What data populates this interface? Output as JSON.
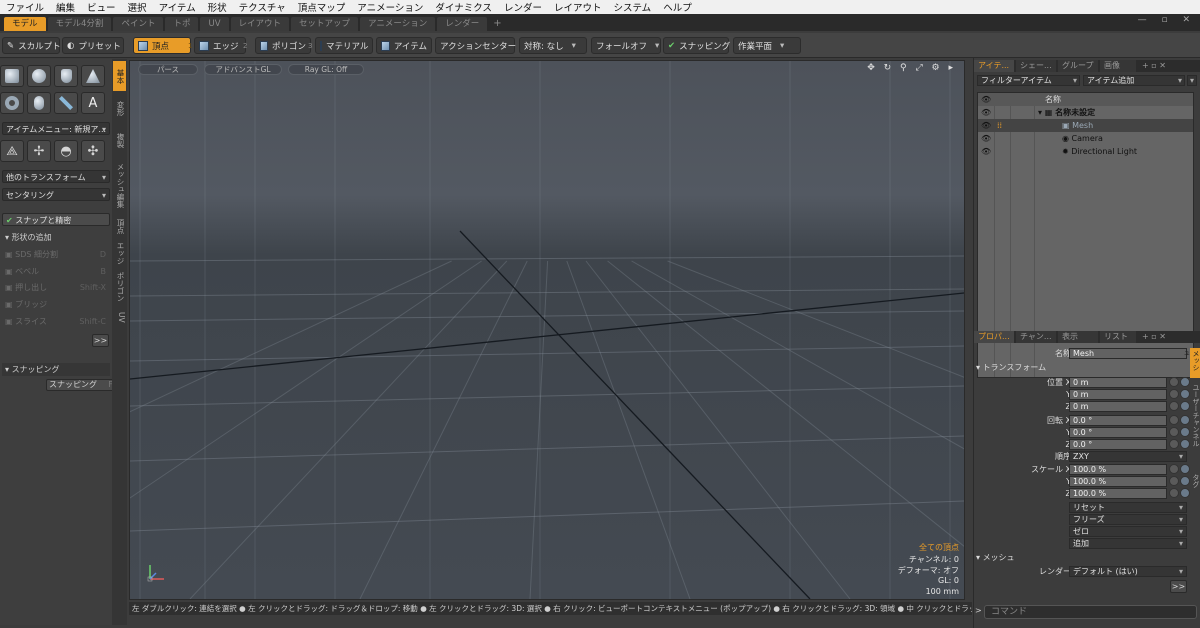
{
  "menubar": [
    "ファイル",
    "編集",
    "ビュー",
    "選択",
    "アイテム",
    "形状",
    "テクスチャ",
    "頂点マップ",
    "アニメーション",
    "ダイナミクス",
    "レンダー",
    "レイアウト",
    "システム",
    "ヘルプ"
  ],
  "layout_tabs": [
    {
      "label": "モデル",
      "active": true
    },
    {
      "label": "モデル4分割",
      "active": false
    },
    {
      "label": "ペイント",
      "active": false
    },
    {
      "label": "トポ",
      "active": false
    },
    {
      "label": "UV",
      "active": false
    },
    {
      "label": "レイアウト",
      "active": false
    },
    {
      "label": "セットアップ",
      "active": false
    },
    {
      "label": "アニメーション",
      "active": false
    },
    {
      "label": "レンダー",
      "active": false
    }
  ],
  "layout_tabs_add": "+",
  "window_controls": "— ▫ ✕",
  "toolbar": {
    "sculpt": "スカルプト",
    "preset": "プリセット",
    "vertex": "頂点",
    "vertex_num": "1",
    "edge": "エッジ",
    "edge_num": "2",
    "polygon": "ポリゴン",
    "polygon_num": "3",
    "material": "マテリアル",
    "item": "アイテム",
    "action_center": "アクションセンター",
    "symmetry": "対称: なし",
    "falloff": "フォールオフ",
    "snapping": "スナッピング",
    "workplane": "作業平面"
  },
  "left_panel": {
    "item_menu": "アイテムメニュー: 新規ア...",
    "other_transform": "他のトランスフォーム",
    "centering": "センタリング",
    "snap_precise": "スナップと精密",
    "add_shape": "形状の追加",
    "tools": [
      {
        "label": "SDS 細分割",
        "shortcut": "D"
      },
      {
        "label": "ベベル",
        "shortcut": "B"
      },
      {
        "label": "押し出し",
        "shortcut": "Shift-X"
      },
      {
        "label": "ブリッジ",
        "shortcut": ""
      },
      {
        "label": "スライス",
        "shortcut": "Shift-C"
      }
    ],
    "more": ">>",
    "snapping_section": "スナッピング",
    "snapping_item": "スナッピング",
    "snapping_shortcut": "F11"
  },
  "vertical_tabs": [
    "基本",
    "変形",
    "複製",
    "メッシュ編集",
    "頂点",
    "エッジ",
    "ポリゴン",
    "UV"
  ],
  "viewport": {
    "mode_buttons": [
      "パース",
      "アドバンストGL",
      "Ray GL: Off"
    ],
    "icons": "✥ ↻ ⚲ ⤢ ⚙ ▸",
    "stats_title": "全ての頂点",
    "stats": [
      "チャンネル: 0",
      "デフォーマ: オフ",
      "GL: 0",
      "100 mm"
    ],
    "axis_y": "Y",
    "axis_x": "X",
    "axis_z": "Z",
    "colors": {
      "stats_title": "#e89c28",
      "accent": "#e89c28"
    }
  },
  "status_bar": "左 ダブルクリック: 連結を選択 ● 左 クリックとドラッグ: ドラッグ＆ドロップ: 移動 ● 左 クリックとドラッグ: 3D: 選択 ● 右 クリック: ビューポートコンテキストメニュー (ポップアップ) ● 右 クリックとドラッグ: 3D: 領域 ● 中 クリックとドラッグ: 3D:",
  "items_panel": {
    "tabs": [
      "アイテ...",
      "シェー...",
      "グループ",
      "画像"
    ],
    "filter": "フィルターアイテム",
    "add_item": "アイテム追加",
    "name_header": "名称",
    "scene": "名称未設定",
    "items": [
      "Mesh",
      "Camera",
      "Directional Light"
    ]
  },
  "properties_panel": {
    "tabs": [
      "プロパ...",
      "チャン...",
      "表示",
      "リスト"
    ],
    "name_label": "名称",
    "name_value": "Mesh",
    "transform": "トランスフォーム",
    "position_label": "位置 X",
    "position": [
      "0 m",
      "0 m",
      "0 m"
    ],
    "rotation_label": "回転 X",
    "rotation": [
      "0.0 °",
      "0.0 °",
      "0.0 °"
    ],
    "order_label": "順序",
    "order_value": "ZXY",
    "scale_label": "スケール X",
    "scale": [
      "100.0 %",
      "100.0 %",
      "100.0 %"
    ],
    "y": "Y",
    "z": "Z",
    "buttons": [
      "リセット",
      "フリーズ",
      "ゼロ",
      "追加"
    ],
    "mesh_section": "メッシュ",
    "render_label": "レンダー",
    "render_value": "デフォルト (はい)",
    "more": ">>",
    "side_tabs": [
      "メッシュ",
      "ユーザーチャンネル",
      "タグ"
    ]
  },
  "command_placeholder": "コマンド",
  "command_arrow": ">"
}
